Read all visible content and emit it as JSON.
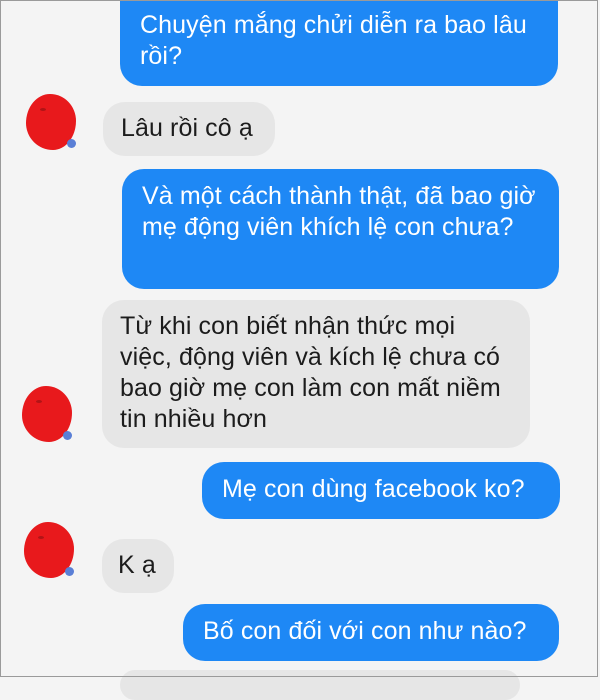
{
  "messages": [
    {
      "sender": "outgoing",
      "text": "Chuyện mắng chửi diễn ra bao lâu rồi?"
    },
    {
      "sender": "incoming",
      "text": "Lâu rồi cô ạ"
    },
    {
      "sender": "outgoing",
      "text": "Và một cách thành thật, đã bao giờ mẹ động viên khích lệ con chưa?"
    },
    {
      "sender": "incoming",
      "text": "Từ khi con biết nhận thức mọi việc, động viên và kích lệ chưa có bao giờ mẹ con làm con mất niềm tin nhiều hơn"
    },
    {
      "sender": "outgoing",
      "text": "Mẹ con dùng facebook ko?"
    },
    {
      "sender": "incoming",
      "text": "K ạ"
    },
    {
      "sender": "outgoing",
      "text": "Bố con đối với con như nào?"
    }
  ],
  "colors": {
    "outgoing_bubble": "#1e88f5",
    "incoming_bubble": "#e6e6e6",
    "avatar_redaction": "#e8191c"
  }
}
